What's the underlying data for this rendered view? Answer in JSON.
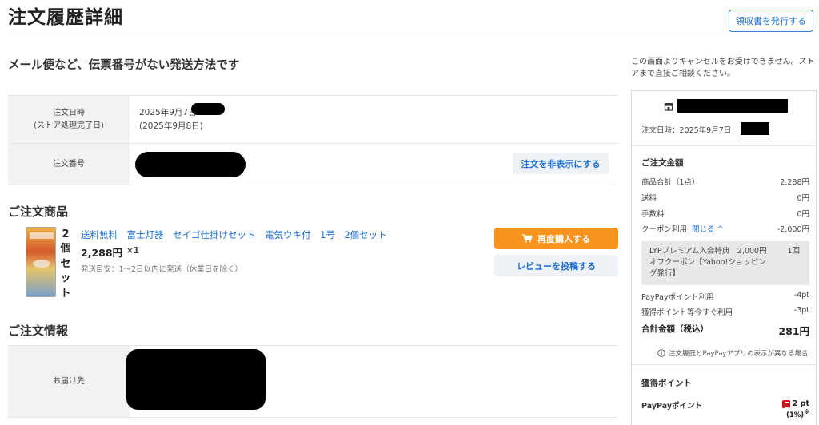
{
  "header": {
    "title": "注文履歴詳細",
    "receipt_button": "領収書を発行する"
  },
  "shipping_message": "メール便など、伝票番号がない発送方法です",
  "order_info": {
    "date_label_line1": "注文日時",
    "date_label_line2": "(ストア処理完了日)",
    "date_value": "2025年9月7日",
    "date_processed": "(2025年9月8日)",
    "number_label": "注文番号",
    "hide_button": "注文を非表示にする"
  },
  "products_section": {
    "title": "ご注文商品",
    "set_label": "2個セット",
    "item": {
      "name": "送料無料　富士灯器　セイゴ仕掛けセット　電気ウキ付　1号　2個セット",
      "price": "2,288円",
      "quantity": "×1",
      "shipping_estimate": "発送目安：1〜2日以内に発送（休業日を除く）"
    },
    "rebuy_button": "再度購入する",
    "review_button": "レビューを投稿する"
  },
  "order_detail_section": {
    "title": "ご注文情報",
    "delivery_label": "お届け先"
  },
  "side_panel": {
    "cancel_note": "この画面よりキャンセルをお受けできません。ストアまで直接ご相談ください。",
    "order_date_prefix": "注文日時：2025年9月7日",
    "amount_title": "ご注文金額",
    "rows": [
      {
        "label": "商品合計（1点）",
        "value": "2,288円"
      },
      {
        "label": "送料",
        "value": "0円"
      },
      {
        "label": "手数料",
        "value": "0円"
      }
    ],
    "coupon_label": "クーポン利用",
    "coupon_close": "閉じる",
    "coupon_value": "-2,000円",
    "coupon_detail": "LYPプレミアム入会特典　2,000円オフクーポン【Yahoo!ショッピング発行】",
    "coupon_count": "1回",
    "paypay_use_label": "PayPayポイント利用",
    "paypay_use_value": "-4pt",
    "earned_use_label": "獲得ポイント等今すぐ利用",
    "earned_use_value": "-3pt",
    "total_label": "合計金額（税込）",
    "total_value": "281円",
    "note": "注文履歴とPayPayアプリの表示が異なる場合",
    "points_title": "獲得ポイント",
    "paypay_points_label": "PayPayポイント",
    "paypay_points_value": "2 pt",
    "paypay_points_rate": "(1%)",
    "paypay_points_mark": "※"
  },
  "colors": {
    "accent_blue": "#1a6fd1",
    "rebuy_orange": "#f7931e",
    "paypay_red": "#e60012"
  }
}
